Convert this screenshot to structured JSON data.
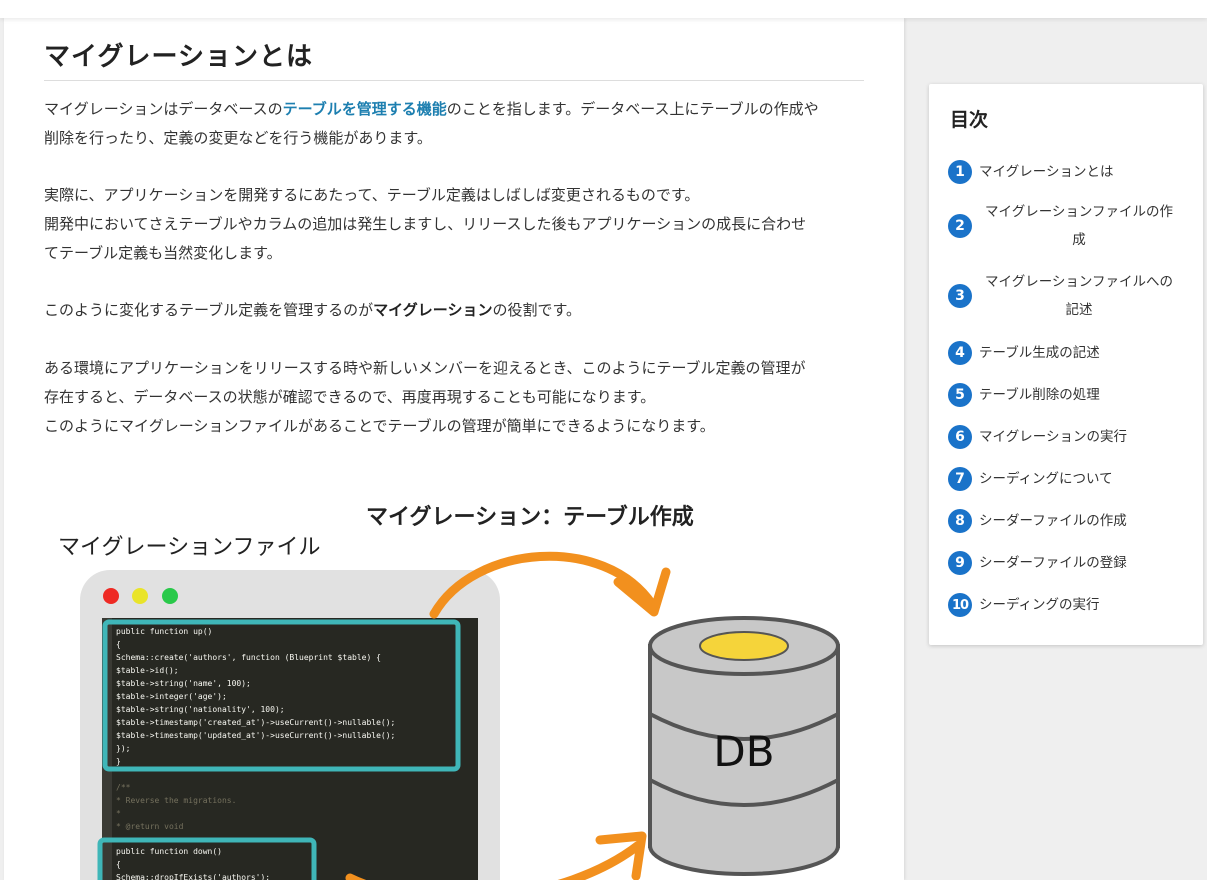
{
  "article": {
    "title": "マイグレーションとは",
    "p1": {
      "pre": "マイグレーションはデータベースの",
      "link": "テーブルを管理する機能",
      "post": "のことを指します。データベース上にテーブルの作成や",
      "line2": "削除を行ったり、定義の変更などを行う機能があります。"
    },
    "p2": [
      "実際に、アプリケーションを開発するにあたって、テーブル定義はしばしば変更されるものです。",
      "開発中においてさえテーブルやカラムの追加は発生しますし、リリースした後もアプリケーションの成長に合わせ",
      "てテーブル定義も当然変化します。"
    ],
    "p3": {
      "pre": "このように変化するテーブル定義を管理するのが",
      "bold": "マイグレーション",
      "post": "の役割です。"
    },
    "p4": [
      "ある環境にアプリケーションをリリースする時や新しいメンバーを迎えるとき、このようにテーブル定義の管理が",
      "存在すると、データベースの状態が確認できるので、再度再現することも可能になります。",
      "このようにマイグレーションファイルがあることでテーブルの管理が簡単にできるようになります。"
    ]
  },
  "figure": {
    "arrow_label": "マイグレーション：テーブル作成",
    "file_label": "マイグレーションファイル",
    "db_label": "DB",
    "code_up": [
      "public function up()",
      "{",
      "    Schema::create('authors', function (Blueprint $table) {",
      "        $table->id();",
      "        $table->string('name', 100);",
      "        $table->integer('age');",
      "        $table->string('nationality', 100);",
      "        $table->timestamp('created_at')->useCurrent()->nullable();",
      "        $table->timestamp('updated_at')->useCurrent()->nullable();",
      "    });",
      "}"
    ],
    "code_comment": [
      "/**",
      " * Reverse the migrations.",
      " *",
      " * @return void"
    ],
    "code_down": [
      "public function down()",
      "{",
      "    Schema::dropIfExists('authors');",
      "}"
    ],
    "colors": {
      "highlight_border": "#3fb6b8",
      "arrow": "#f2901e",
      "db_top": "#f5d43a",
      "db_body": "#c8c8c8"
    }
  },
  "toc": {
    "title": "目次",
    "items": [
      {
        "num": "1",
        "label": "マイグレーションとは"
      },
      {
        "num": "2",
        "label": "マイグレーションファイルの作成"
      },
      {
        "num": "3",
        "label": "マイグレーションファイルへの記述"
      },
      {
        "num": "4",
        "label": "テーブル生成の記述"
      },
      {
        "num": "5",
        "label": "テーブル削除の処理"
      },
      {
        "num": "6",
        "label": "マイグレーションの実行"
      },
      {
        "num": "7",
        "label": "シーディングについて"
      },
      {
        "num": "8",
        "label": "シーダーファイルの作成"
      },
      {
        "num": "9",
        "label": "シーダーファイルの登録"
      },
      {
        "num": "10",
        "label": "シーディングの実行"
      }
    ]
  }
}
